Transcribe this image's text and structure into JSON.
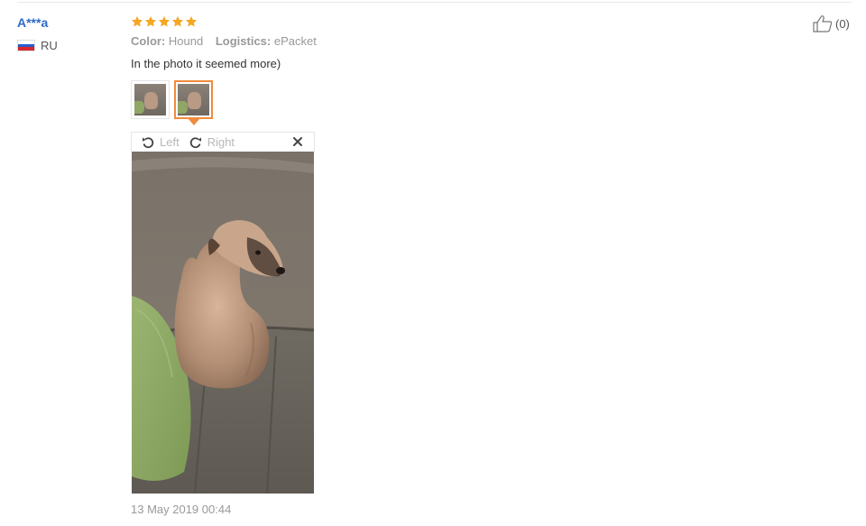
{
  "buyer": {
    "name": "A***a",
    "country": "RU",
    "flag_colors": [
      "#ffffff",
      "#2b5cc7",
      "#d8262d"
    ]
  },
  "review": {
    "rating": 5,
    "star_color": "#f5a623",
    "color_label": "Color:",
    "color_value": "Hound",
    "logistics_label": "Logistics:",
    "logistics_value": "ePacket",
    "text": "In the photo it seemed more)",
    "date": "13 May 2019 00:44"
  },
  "photos": {
    "thumbnails": [
      {
        "icon": "photo-thumbnail",
        "selected": false
      },
      {
        "icon": "photo-thumbnail",
        "selected": true
      }
    ],
    "selected_index": 2,
    "accent_color": "#f08a3c"
  },
  "viewer": {
    "rotate_left_label": "Left",
    "rotate_right_label": "Right",
    "close_icon": "close-icon",
    "image_subject": "dog-shaped pillow on a sofa"
  },
  "helpful": {
    "icon": "thumbs-up-icon",
    "count": "(0)"
  }
}
